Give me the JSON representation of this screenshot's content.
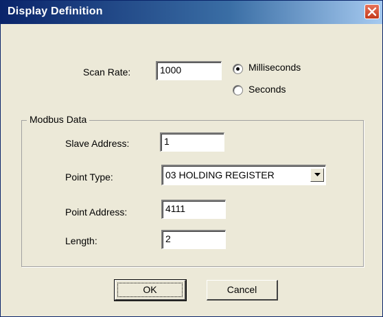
{
  "window": {
    "title": "Display Definition"
  },
  "scan": {
    "label": "Scan Rate:",
    "value": "1000",
    "units": [
      {
        "label": "Milliseconds",
        "selected": true
      },
      {
        "label": "Seconds",
        "selected": false
      }
    ]
  },
  "modbus": {
    "legend": "Modbus Data",
    "slave_address": {
      "label": "Slave Address:",
      "value": "1"
    },
    "point_type": {
      "label": "Point Type:",
      "value": "03 HOLDING REGISTER"
    },
    "point_address": {
      "label": "Point Address:",
      "value": "4111"
    },
    "length": {
      "label": "Length:",
      "value": "2"
    }
  },
  "buttons": {
    "ok": "OK",
    "cancel": "Cancel"
  },
  "colors": {
    "titlebar": "#0a246a",
    "dialog_bg": "#ece9d8",
    "close": "#c33a1a"
  }
}
